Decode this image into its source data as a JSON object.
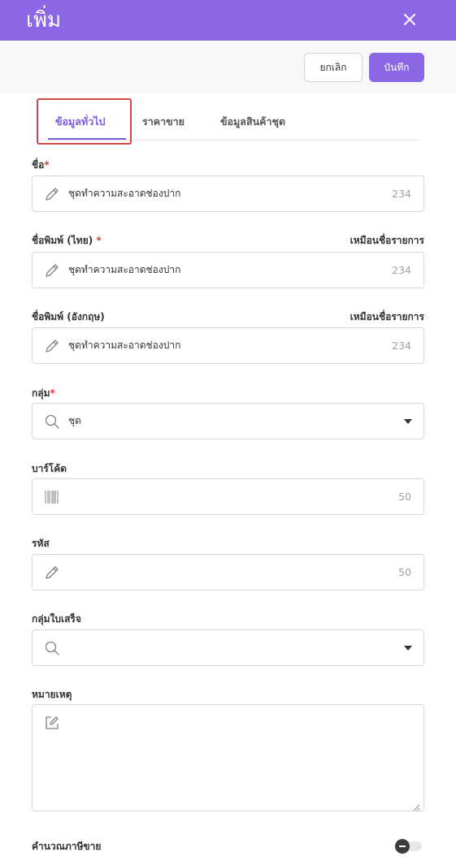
{
  "header": {
    "title": "เพิ่ม"
  },
  "toolbar": {
    "cancel_label": "ยกเลิก",
    "save_label": "บันทึก"
  },
  "tabs": [
    {
      "label": "ข้อมูลทั่วไป",
      "active": true
    },
    {
      "label": "ราคาขาย",
      "active": false
    },
    {
      "label": "ข้อมูลสินค้าชุด",
      "active": false
    }
  ],
  "form": {
    "name": {
      "label": "ชื่อ",
      "required_mark": "*",
      "value": "ชุดทำความสะอาดช่องปาก",
      "counter": "234",
      "icon": "pencil-icon"
    },
    "print_name_th": {
      "label": "ชื่อพิมพ์ (ไทย)",
      "required_mark": "*",
      "side_link": "เหมือนชื่อรายการ",
      "value": "ชุดทำความสะอาดช่องปาก",
      "counter": "234",
      "icon": "pencil-icon"
    },
    "print_name_en": {
      "label": "ชื่อพิมพ์ (อังกฤษ)",
      "side_link": "เหมือนชื่อรายการ",
      "value": "ชุดทำความสะอาดช่องปาก",
      "counter": "234",
      "icon": "pencil-icon"
    },
    "group": {
      "label": "กลุ่ม",
      "required_mark": "*",
      "value": "ชุด",
      "icon": "search-icon"
    },
    "barcode": {
      "label": "บาร์โค้ด",
      "value": "",
      "counter": "50",
      "icon": "barcode-icon"
    },
    "code": {
      "label": "รหัส",
      "value": "",
      "counter": "50",
      "icon": "pencil-icon"
    },
    "receipt_group": {
      "label": "กลุ่มใบเสร็จ",
      "value": "",
      "icon": "search-icon"
    },
    "note": {
      "label": "หมายเหตุ",
      "value": "",
      "icon": "edit-note-icon"
    },
    "calc_sales_tax": {
      "label": "คำนวณภาษีขาย",
      "enabled": false
    }
  },
  "colors": {
    "accent": "#8b67e6",
    "required": "#e03b3b",
    "highlight": "#d04545"
  }
}
